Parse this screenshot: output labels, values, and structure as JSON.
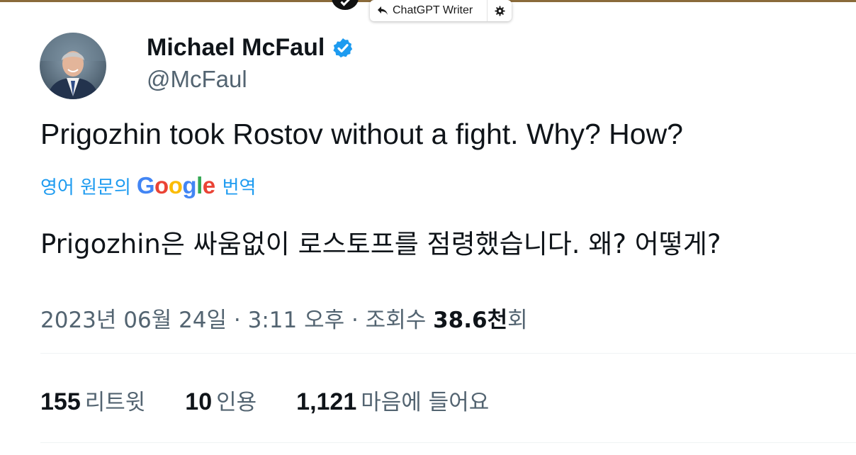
{
  "extension": {
    "label": "ChatGPT Writer",
    "icon": "reply-arrow-icon",
    "settings_icon": "gear-icon"
  },
  "tweet": {
    "author_name": "Michael McFaul",
    "author_handle": "@McFaul",
    "text": "Prigozhin took Rostov without a fight. Why? How?",
    "translate_prefix": "영어 원문의",
    "translate_brand": "Google",
    "translate_suffix": "번역",
    "translated_text": "Prigozhin은 싸움없이 로스토프를 점령했습니다. 왜? 어떻게?",
    "timestamp": "2023년 06월 24일 · 3:11 오후 · 조회수",
    "views_count": "38.6천",
    "views_suffix": "회"
  },
  "stats": {
    "retweets_count": "155",
    "retweets_label": "리트윗",
    "quotes_count": "10",
    "quotes_label": "인용",
    "likes_count": "1,121",
    "likes_label": "마음에 들어요"
  },
  "colors": {
    "link_blue": "#1d9bf0",
    "text_primary": "#0f1419",
    "text_secondary": "#536471",
    "verified_blue": "#1d9bf0",
    "google_blue": "#4285f4",
    "google_red": "#ea4335",
    "google_yellow": "#fbbc05",
    "google_green": "#34a853"
  }
}
